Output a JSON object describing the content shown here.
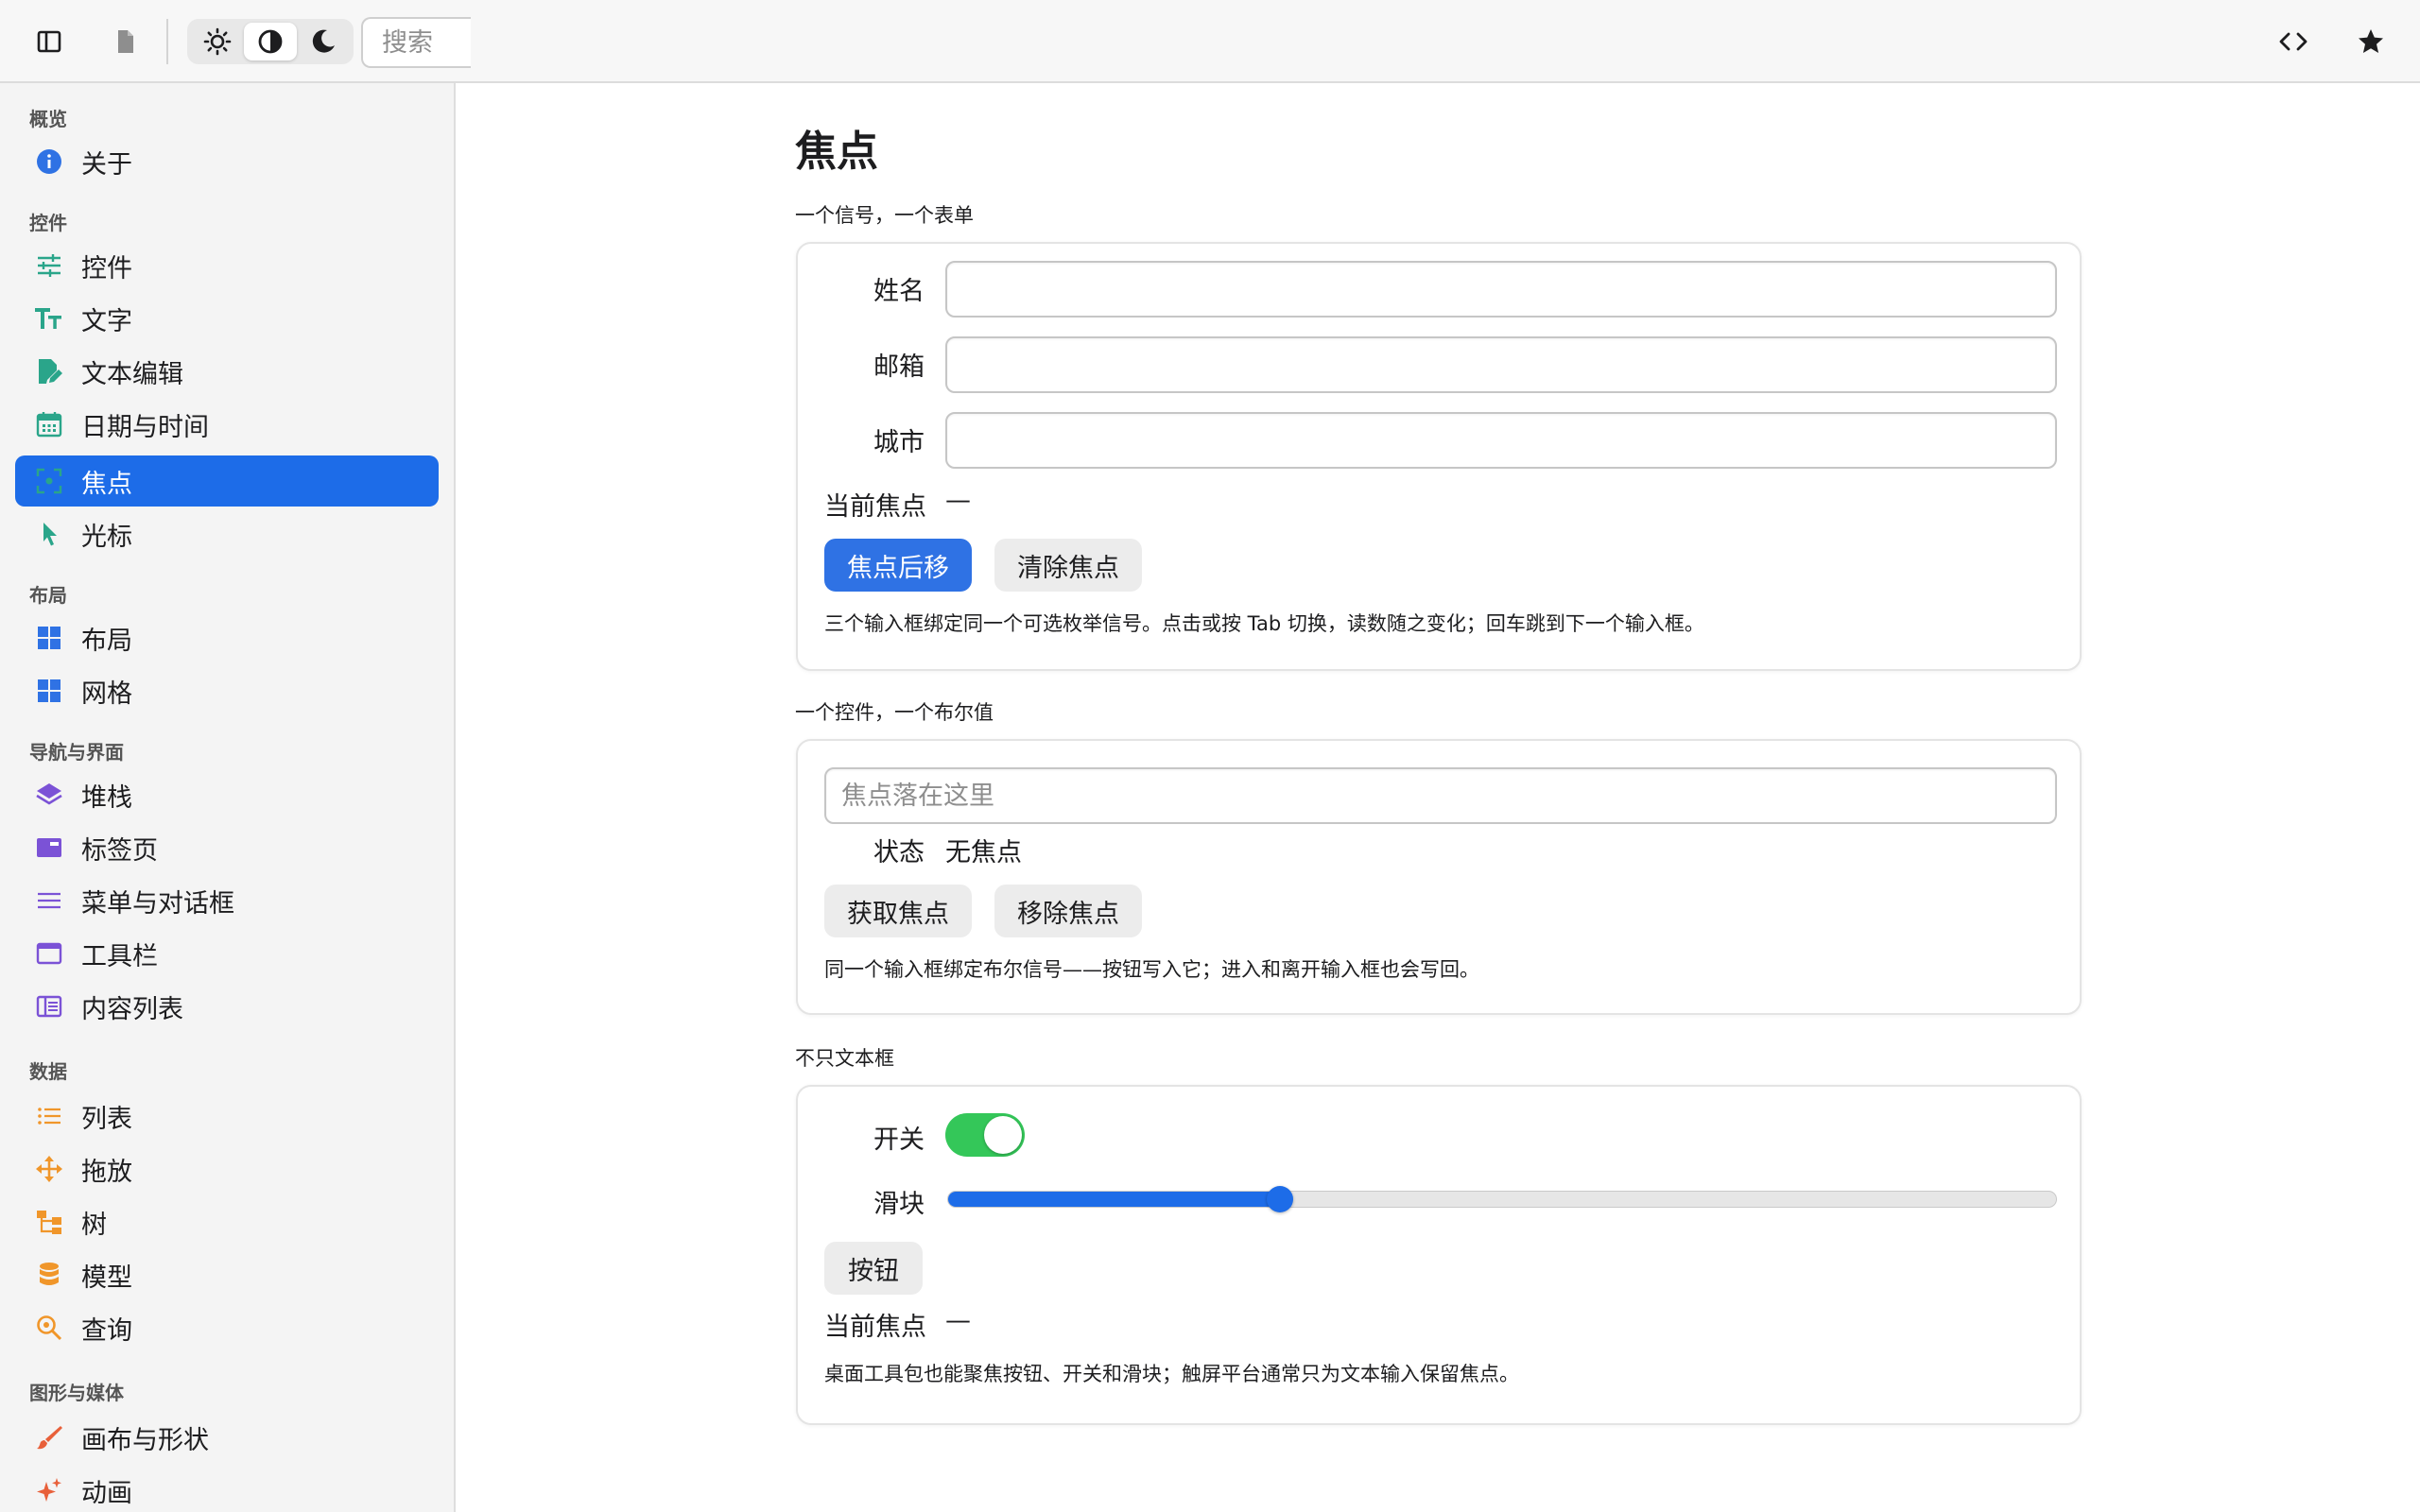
{
  "toolbar": {
    "search_placeholder": "搜索",
    "theme_modes": [
      "light",
      "auto",
      "dark"
    ],
    "active_theme": "auto"
  },
  "sidebar": {
    "sections": [
      {
        "title": "概览",
        "items": [
          {
            "label": "关于",
            "icon": "info-icon",
            "color": "#2f72e4"
          }
        ]
      },
      {
        "title": "控件",
        "items": [
          {
            "label": "控件",
            "icon": "sliders-icon",
            "color": "#2aa58a"
          },
          {
            "label": "文字",
            "icon": "text-size-icon",
            "color": "#2aa58a"
          },
          {
            "label": "文本编辑",
            "icon": "edit-document-icon",
            "color": "#2aa58a"
          },
          {
            "label": "日期与时间",
            "icon": "calendar-icon",
            "color": "#2aa58a"
          },
          {
            "label": "焦点",
            "icon": "focus-icon",
            "color": "#2aa58a",
            "active": true
          },
          {
            "label": "光标",
            "icon": "pointer-icon",
            "color": "#2aa58a"
          }
        ]
      },
      {
        "title": "布局",
        "items": [
          {
            "label": "布局",
            "icon": "layout-grid-icon",
            "color": "#2f72e4"
          },
          {
            "label": "网格",
            "icon": "grid-icon",
            "color": "#2f72e4"
          }
        ]
      },
      {
        "title": "导航与界面",
        "items": [
          {
            "label": "堆栈",
            "icon": "layers-icon",
            "color": "#7b52d6"
          },
          {
            "label": "标签页",
            "icon": "tabs-icon",
            "color": "#7b52d6"
          },
          {
            "label": "菜单与对话框",
            "icon": "menu-icon",
            "color": "#7b52d6"
          },
          {
            "label": "工具栏",
            "icon": "window-icon",
            "color": "#7b52d6"
          },
          {
            "label": "内容列表",
            "icon": "columns-icon",
            "color": "#7b52d6"
          }
        ]
      },
      {
        "title": "数据",
        "items": [
          {
            "label": "列表",
            "icon": "list-icon",
            "color": "#f0962a"
          },
          {
            "label": "拖放",
            "icon": "move-icon",
            "color": "#f0962a"
          },
          {
            "label": "树",
            "icon": "tree-icon",
            "color": "#f0962a"
          },
          {
            "label": "模型",
            "icon": "database-icon",
            "color": "#f0962a"
          },
          {
            "label": "查询",
            "icon": "search-icon",
            "color": "#f0962a"
          }
        ]
      },
      {
        "title": "图形与媒体",
        "items": [
          {
            "label": "画布与形状",
            "icon": "brush-icon",
            "color": "#e8603a"
          },
          {
            "label": "动画",
            "icon": "sparkle-icon",
            "color": "#e8603a"
          }
        ]
      }
    ]
  },
  "main": {
    "title": "焦点",
    "group1": {
      "title": "一个信号，一个表单",
      "fields": [
        {
          "label": "姓名",
          "value": ""
        },
        {
          "label": "邮箱",
          "value": ""
        },
        {
          "label": "城市",
          "value": ""
        }
      ],
      "current_focus_label": "当前焦点",
      "current_focus_value": "—",
      "btn_next": "焦点后移",
      "btn_clear": "清除焦点",
      "note": "三个输入框绑定同一个可选枚举信号。点击或按 Tab 切换，读数随之变化；回车跳到下一个输入框。"
    },
    "group2": {
      "title": "一个控件，一个布尔值",
      "input_placeholder": "焦点落在这里",
      "status_label": "状态",
      "status_value": "无焦点",
      "btn_focus": "获取焦点",
      "btn_blur": "移除焦点",
      "note": "同一个输入框绑定布尔信号——按钮写入它；进入和离开输入框也会写回。"
    },
    "group3": {
      "title": "不只文本框",
      "switch_label": "开关",
      "switch_on": true,
      "slider_label": "滑块",
      "slider_value": 0.3,
      "button_label": "按钮",
      "current_focus_label": "当前焦点",
      "current_focus_value": "—",
      "note": "桌面工具包也能聚焦按钮、开关和滑块；触屏平台通常只为文本输入保留焦点。"
    }
  }
}
